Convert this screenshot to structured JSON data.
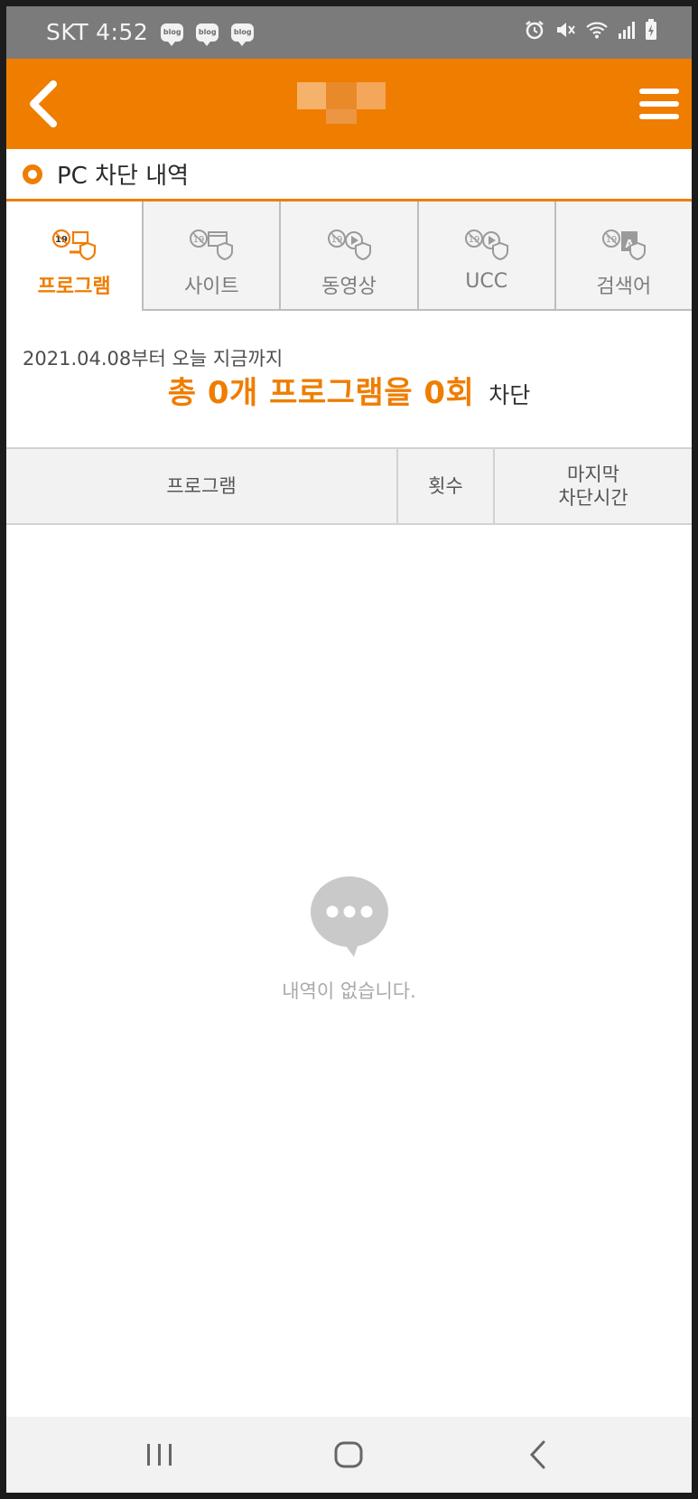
{
  "status_bar": {
    "carrier": "SKT",
    "time": "4:52",
    "notifications": [
      {
        "label": "blog",
        "icon": "blog-notification-icon"
      },
      {
        "label": "blog",
        "icon": "blog-notification-icon"
      },
      {
        "label": "blog",
        "icon": "blog-notification-icon"
      }
    ],
    "icons": [
      "alarm-icon",
      "mute-icon",
      "wifi-icon",
      "signal-icon",
      "battery-icon"
    ]
  },
  "header": {
    "back_icon": "back-arrow-icon",
    "menu_icon": "hamburger-menu-icon",
    "brand_color": "#ef7d00"
  },
  "section": {
    "title": "PC 차단 내역"
  },
  "tabs": [
    {
      "label": "프로그램",
      "active": true,
      "icon": "program-block-icon"
    },
    {
      "label": "사이트",
      "active": false,
      "icon": "site-block-icon"
    },
    {
      "label": "동영상",
      "active": false,
      "icon": "video-block-icon"
    },
    {
      "label": "UCC",
      "active": false,
      "icon": "ucc-block-icon"
    },
    {
      "label": "검색어",
      "active": false,
      "icon": "search-term-block-icon"
    }
  ],
  "summary": {
    "date_text": "2021.04.08부터 오늘 지금까지",
    "total_text": "총 0개 프로그램을 0회",
    "suffix": "차단"
  },
  "table": {
    "columns": [
      "프로그램",
      "횟수",
      "마지막",
      "차단시간"
    ]
  },
  "empty_state": {
    "icon": "speech-bubble-icon",
    "message": "내역이 없습니다."
  },
  "nav_bar": {
    "buttons": [
      "recent-apps-icon",
      "home-icon",
      "back-icon"
    ]
  }
}
